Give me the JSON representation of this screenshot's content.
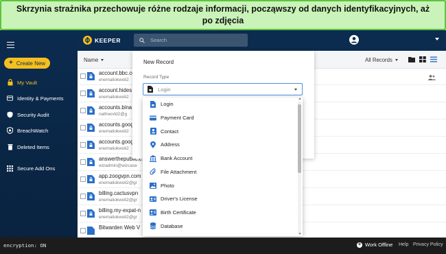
{
  "banner": {
    "text": "Skrzynia strażnika przechowuje różne rodzaje informacji, począwszy od danych identyfikacyjnych, aż po zdjęcia"
  },
  "app": {
    "logo": "KEEPER"
  },
  "search": {
    "placeholder": "Search"
  },
  "sidebar": {
    "create_label": "Create New",
    "items": [
      {
        "label": "My Vault",
        "icon": "lock-icon"
      },
      {
        "label": "Identity & Payments",
        "icon": "id-card-icon"
      },
      {
        "label": "Security Audit",
        "icon": "shield-icon"
      },
      {
        "label": "BreachWatch",
        "icon": "breachwatch-icon"
      },
      {
        "label": "Deleted Items",
        "icon": "trash-icon"
      },
      {
        "label": "Secure Add Ons",
        "icon": "grid-icon"
      }
    ]
  },
  "list": {
    "name_header": "Name",
    "filter": "All Records",
    "records": [
      {
        "title": "account.bbc.co",
        "subtitle": "enemaliokwoli2"
      },
      {
        "title": "account.hides",
        "subtitle": "enemaliokwoli2"
      },
      {
        "title": "accounts.bina",
        "subtitle": "nathworld2@g"
      },
      {
        "title": "accounts.goog",
        "subtitle": "enemaliokwoli2"
      },
      {
        "title": "accounts.goog",
        "subtitle": "enemaliokwoli2"
      },
      {
        "title": "answerthepublic.c",
        "subtitle": "wizadmin@wizcase"
      },
      {
        "title": "app.zoogvpn.com",
        "subtitle": "enemaliokwoli2@gr"
      },
      {
        "title": "billing.cactusvpn",
        "subtitle": "enemaliokwoli2@gr"
      },
      {
        "title": "billing.my-expat-n",
        "subtitle": "enemaliokwoli2@gr"
      },
      {
        "title": "Bitwarden Web V",
        "subtitle": ""
      }
    ]
  },
  "modal": {
    "title": "New Record",
    "record_type_label": "Record Type",
    "record_type_value": "Login"
  },
  "dropdown": {
    "options": [
      {
        "label": "Login",
        "icon": "login-icon"
      },
      {
        "label": "Payment Card",
        "icon": "credit-card-icon"
      },
      {
        "label": "Contact",
        "icon": "contact-icon"
      },
      {
        "label": "Address",
        "icon": "location-pin-icon"
      },
      {
        "label": "Bank Account",
        "icon": "bank-icon"
      },
      {
        "label": "File Attachment",
        "icon": "paperclip-icon"
      },
      {
        "label": "Photo",
        "icon": "photo-icon"
      },
      {
        "label": "Driver's License",
        "icon": "license-icon"
      },
      {
        "label": "Birth Certificate",
        "icon": "certificate-icon"
      },
      {
        "label": "Database",
        "icon": "database-icon"
      }
    ]
  },
  "footer": {
    "encryption": "encryption: ON",
    "work_offline": "Work Offline",
    "help": "Help",
    "privacy": "Privacy Policy"
  },
  "colors": {
    "sidebar_bg": "#0b2b4f",
    "accent_yellow": "#f5bf1f",
    "icon_blue": "#2a6fc9",
    "banner_bg": "#c9f3b8",
    "banner_border": "#5cc43a"
  }
}
